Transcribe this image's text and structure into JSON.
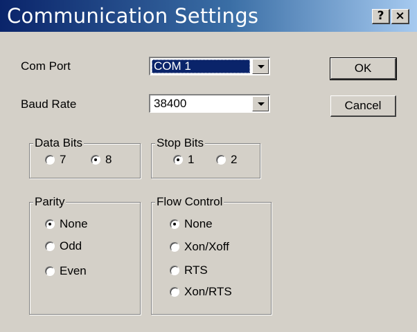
{
  "window": {
    "title": "Communication Settings",
    "help_label": "?",
    "close_label": "×"
  },
  "com_port": {
    "label": "Com Port",
    "value": "COM 1"
  },
  "baud_rate": {
    "label": "Baud Rate",
    "value": "38400"
  },
  "buttons": {
    "ok": "OK",
    "cancel": "Cancel"
  },
  "data_bits": {
    "label": "Data Bits",
    "options": [
      "7",
      "8"
    ],
    "selected": "8"
  },
  "stop_bits": {
    "label": "Stop Bits",
    "options": [
      "1",
      "2"
    ],
    "selected": "1"
  },
  "parity": {
    "label": "Parity",
    "options": [
      "None",
      "Odd",
      "Even"
    ],
    "selected": "None"
  },
  "flow_control": {
    "label": "Flow Control",
    "options": [
      "None",
      "Xon/Xoff",
      "RTS",
      "Xon/RTS"
    ],
    "selected": "None"
  },
  "colors": {
    "title_start": "#0a246a",
    "title_end": "#a6caf0",
    "face": "#d4d0c8",
    "selection": "#0a246a"
  }
}
